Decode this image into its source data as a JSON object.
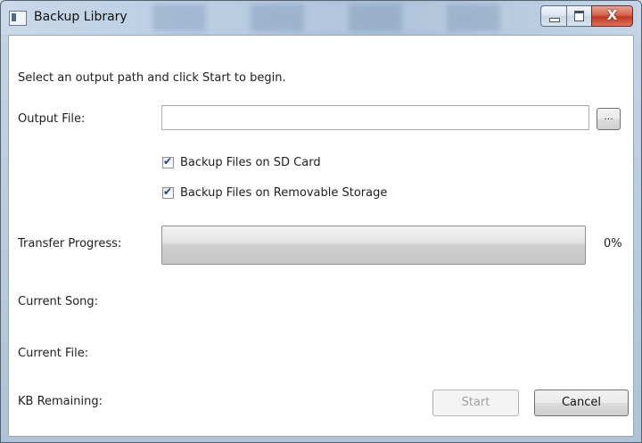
{
  "window": {
    "title": "Backup Library",
    "close_glyph": "X"
  },
  "form": {
    "instructions": "Select an output path and click Start to begin.",
    "output_file_label": "Output File:",
    "output_file_value": "",
    "browse_label": "...",
    "checkbox_sd_label": "Backup Files on SD Card",
    "checkbox_sd_checked": true,
    "checkbox_removable_label": "Backup Files on Removable Storage",
    "checkbox_removable_checked": true,
    "transfer_progress_label": "Transfer Progress:",
    "progress_percent_text": "0%",
    "progress_value": 0,
    "current_song_label": "Current Song:",
    "current_file_label": "Current File:",
    "kb_remaining_label": "KB Remaining:"
  },
  "buttons": {
    "start_label": "Start",
    "start_enabled": false,
    "cancel_label": "Cancel"
  },
  "icons": {
    "app": "app-window-icon",
    "checkmark": "checkmark-icon",
    "minimize": "minimize-icon",
    "maximize": "maximize-icon",
    "close": "close-icon"
  }
}
